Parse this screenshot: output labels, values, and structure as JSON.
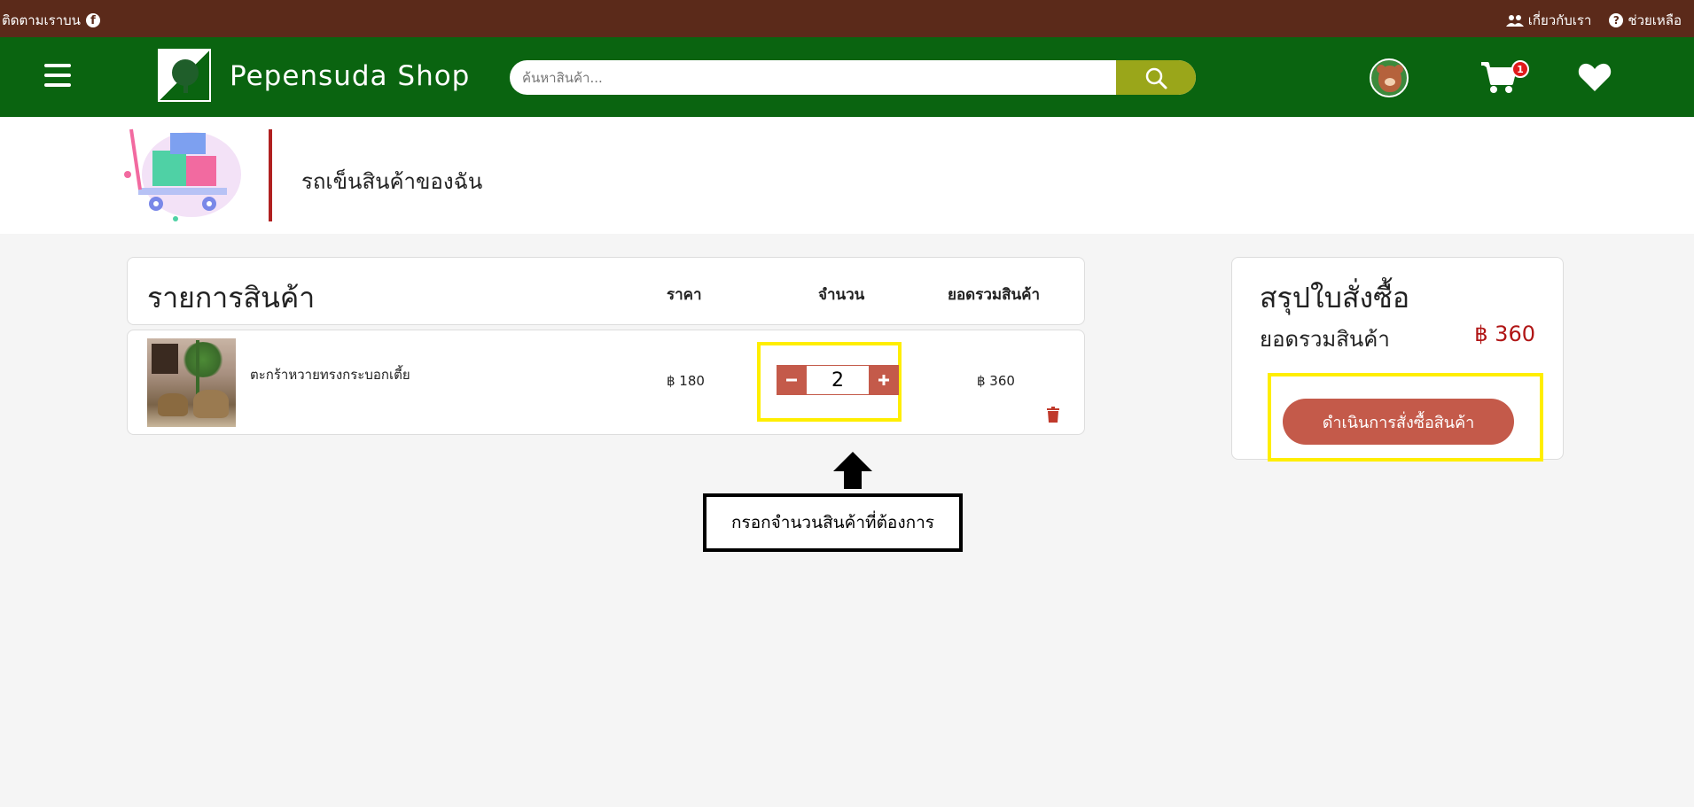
{
  "topbar": {
    "follow_label": "ติดตามเราบน",
    "about_label": "เกี่ยวกับเรา",
    "help_label": "ช่วยเหลือ"
  },
  "header": {
    "brand": "Pepensuda Shop",
    "search_placeholder": "ค้นหาสินค้า...",
    "cart_count": "1"
  },
  "page": {
    "title": "รถเข็นสินค้าของฉัน"
  },
  "cart_list": {
    "heading": "รายการสินค้า",
    "columns": {
      "price": "ราคา",
      "quantity": "จำนวน",
      "subtotal": "ยอดรวมสินค้า"
    },
    "items": [
      {
        "name": "ตะกร้าหวายทรงกระบอกเตี้ย",
        "price": "฿ 180",
        "quantity": "2",
        "subtotal": "฿ 360"
      }
    ]
  },
  "annotation": {
    "note": "กรอกจำนวนสินค้าที่ต้องการ"
  },
  "summary": {
    "title": "สรุปใบสั่งซื้อ",
    "total_label": "ยอดรวมสินค้า",
    "total_value": "฿ 360",
    "checkout_label": "ดำเนินการสั่งซื้อสินค้า"
  },
  "colors": {
    "topbar": "#5b2a1a",
    "header": "#0a6410",
    "search_button": "#9aa61a",
    "accent": "#c45a4a",
    "highlight": "#ffee00",
    "total_text": "#b01515"
  }
}
